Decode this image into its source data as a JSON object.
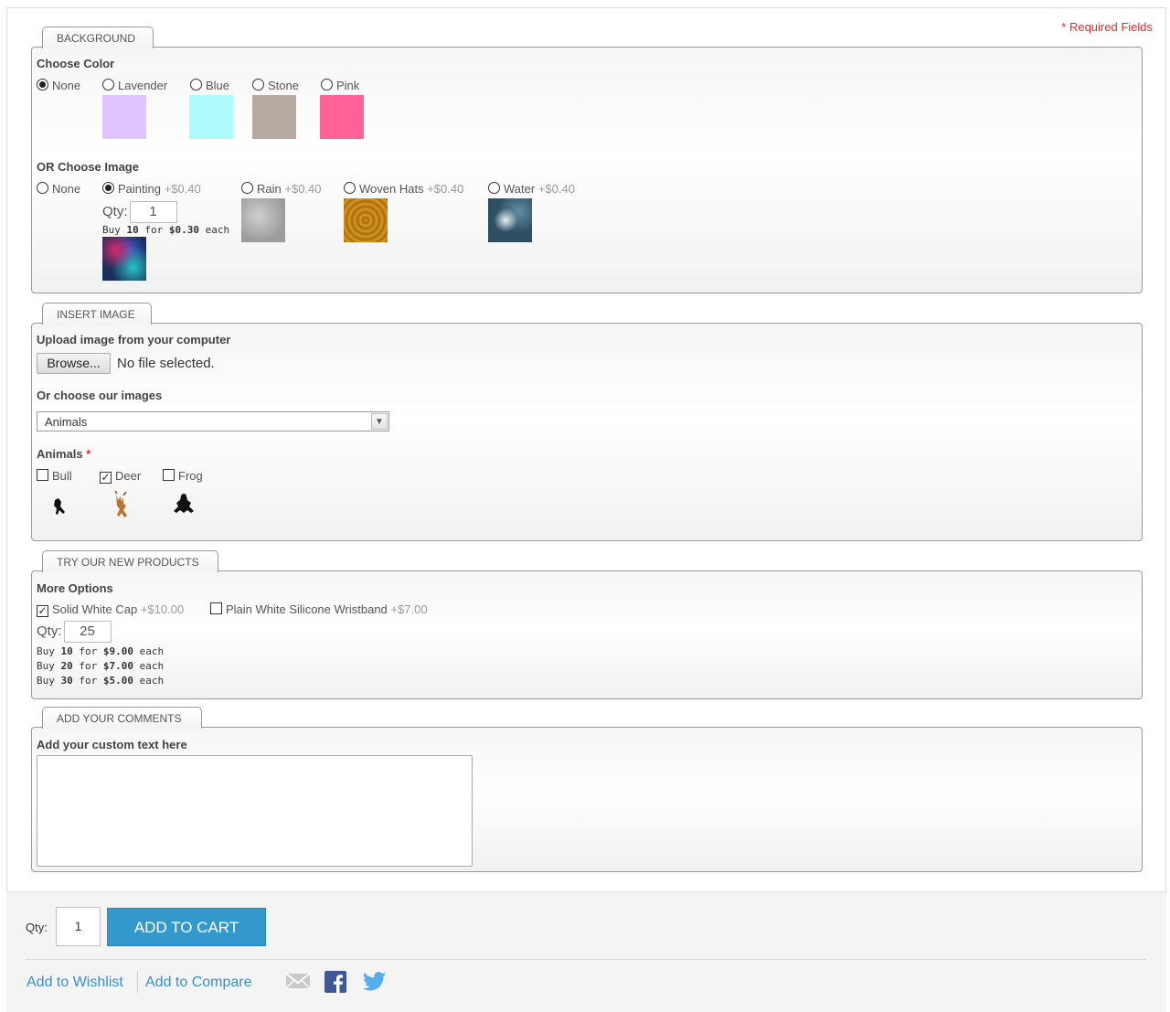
{
  "required_note": "* Required Fields",
  "background": {
    "tab": "BACKGROUND",
    "color_label": "Choose Color",
    "colors": [
      {
        "label": "None",
        "selected": true,
        "swatch": null
      },
      {
        "label": "Lavender",
        "selected": false,
        "swatch": "#e0c4ff"
      },
      {
        "label": "Blue",
        "selected": false,
        "swatch": "#adfbfb"
      },
      {
        "label": "Stone",
        "selected": false,
        "swatch": "#b5aaa0"
      },
      {
        "label": "Pink",
        "selected": false,
        "swatch": "#ff6199"
      }
    ],
    "image_label": "OR Choose Image",
    "images": [
      {
        "label": "None",
        "price": "",
        "selected": false
      },
      {
        "label": "Painting",
        "price": "+$0.40",
        "selected": true
      },
      {
        "label": "Rain",
        "price": "+$0.40",
        "selected": false
      },
      {
        "label": "Woven Hats",
        "price": "+$0.40",
        "selected": false
      },
      {
        "label": "Water",
        "price": "+$0.40",
        "selected": false
      }
    ],
    "qty_label": "Qty:",
    "qty_value": "1",
    "tier": {
      "prefix": "Buy",
      "qty": "10",
      "mid": "for",
      "price": "$0.30",
      "suffix": "each"
    }
  },
  "insert_image": {
    "tab": "INSERT IMAGE",
    "upload_label": "Upload image from your computer",
    "browse_label": "Browse...",
    "no_file": "No file selected.",
    "choose_label": "Or choose our images",
    "select_value": "Animals",
    "animals_label": "Animals",
    "required_mark": "*",
    "animals": [
      {
        "label": "Bull",
        "checked": false,
        "icon": "bull-icon"
      },
      {
        "label": "Deer",
        "checked": true,
        "icon": "deer-icon"
      },
      {
        "label": "Frog",
        "checked": false,
        "icon": "frog-icon"
      }
    ]
  },
  "new_products": {
    "tab": "TRY OUR NEW PRODUCTS",
    "more_label": "More Options",
    "options": [
      {
        "label": "Solid White Cap",
        "price": "+$10.00",
        "checked": true
      },
      {
        "label": "Plain White Silicone Wristband",
        "price": "+$7.00",
        "checked": false
      }
    ],
    "qty_label": "Qty:",
    "qty_value": "25",
    "tiers": [
      {
        "prefix": "Buy",
        "qty": "10",
        "mid": "for",
        "price": "$9.00",
        "suffix": "each"
      },
      {
        "prefix": "Buy",
        "qty": "20",
        "mid": "for",
        "price": "$7.00",
        "suffix": "each"
      },
      {
        "prefix": "Buy",
        "qty": "30",
        "mid": "for",
        "price": "$5.00",
        "suffix": "each"
      }
    ]
  },
  "comments": {
    "tab": "ADD YOUR COMMENTS",
    "label": "Add your custom text here",
    "value": ""
  },
  "cart": {
    "qty_label": "Qty:",
    "qty_value": "1",
    "button": "ADD TO CART",
    "wishlist": "Add to Wishlist",
    "compare": "Add to Compare",
    "accent": "#3399cc",
    "social_icons": [
      "email-icon",
      "facebook-icon",
      "twitter-icon"
    ]
  }
}
